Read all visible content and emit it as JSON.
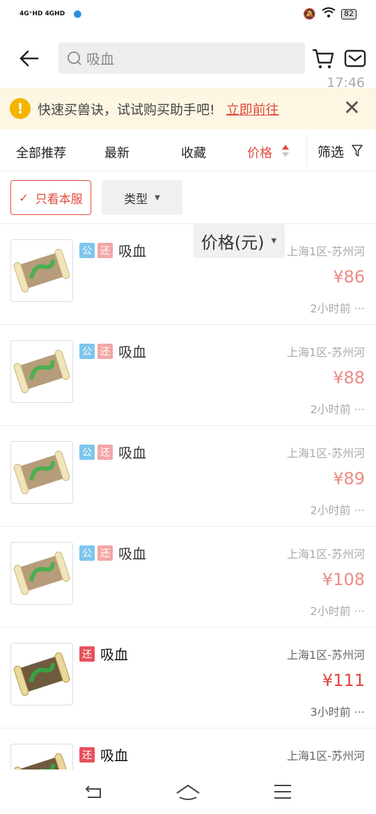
{
  "status": {
    "network": "4G⁺HD 4GHD",
    "time": "17:46",
    "battery": "82"
  },
  "search": {
    "placeholder": "吸血"
  },
  "notice": {
    "message": "快速买兽诀，试试购买助手吧!",
    "link": "立即前往"
  },
  "tabs": [
    {
      "label": "全部推荐"
    },
    {
      "label": "最新"
    },
    {
      "label": "收藏"
    },
    {
      "label": "价格"
    }
  ],
  "filter_label": "筛选",
  "chips": {
    "only_server": "只看本服",
    "type": "类型",
    "price": "价格(元)"
  },
  "items": [
    {
      "name": "吸血",
      "server": "上海1区-苏州河",
      "price": "¥86",
      "time": "2小时前 ···"
    },
    {
      "name": "吸血",
      "server": "上海1区-苏州河",
      "price": "¥88",
      "time": "2小时前 ···"
    },
    {
      "name": "吸血",
      "server": "上海1区-苏州河",
      "price": "¥89",
      "time": "2小时前 ···"
    },
    {
      "name": "吸血",
      "server": "上海1区-苏州河",
      "price": "¥108",
      "time": "2小时前 ···"
    },
    {
      "name": "吸血",
      "server": "上海1区-苏州河",
      "price": "¥111",
      "time": "3小时前 ···"
    },
    {
      "name": "吸血",
      "server": "上海1区-苏州河",
      "price": "",
      "time": ""
    }
  ],
  "tag_labels": {
    "gong": "公",
    "huan": "还"
  },
  "colors": {
    "accent": "#e04a3a",
    "notice_bg": "#fdf6e3"
  }
}
